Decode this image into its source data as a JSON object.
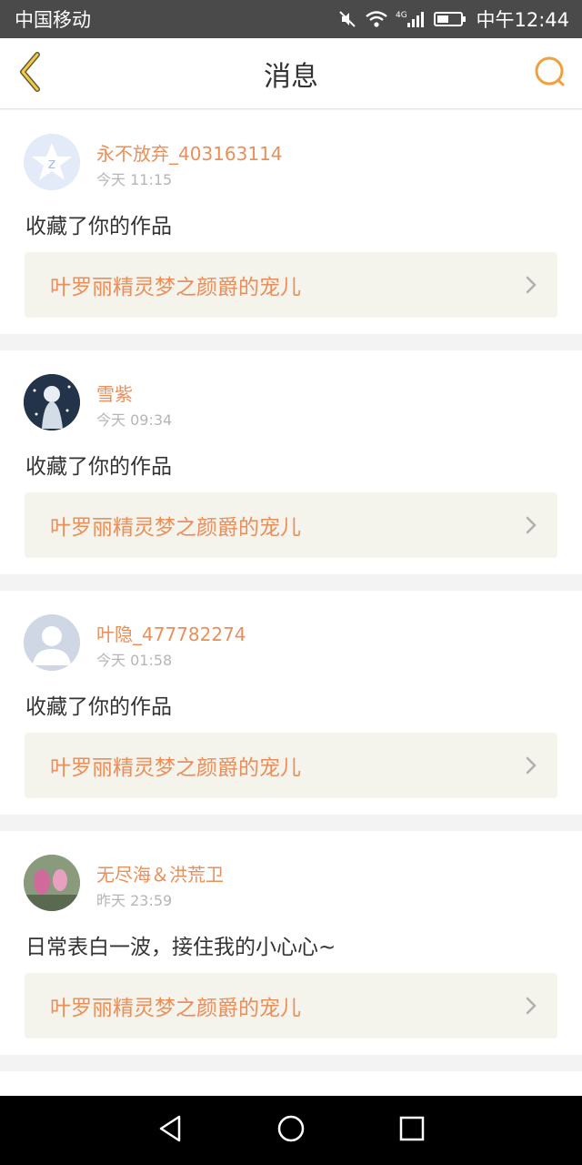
{
  "status_bar": {
    "carrier": "中国移动",
    "network": "4G",
    "time": "中午12:44",
    "icons": [
      "mute-icon",
      "wifi-icon",
      "signal-icon",
      "battery-icon"
    ]
  },
  "header": {
    "title": "消息",
    "back_icon": "chevron-left-icon",
    "search_icon": "search-icon",
    "accent_color": "#f0a03c"
  },
  "colors": {
    "name_color": "#ea8f5a",
    "link_bg": "#f4f3ec",
    "time_color": "#b6b6b6"
  },
  "messages": [
    {
      "user": "永不放弃_403163114",
      "time": "今天 11:15",
      "action": "收藏了你的作品",
      "work_title": "叶罗丽精灵梦之颜爵的宠儿",
      "avatar": "default-qq-avatar"
    },
    {
      "user": "雪紫",
      "time": "今天 09:34",
      "action": "收藏了你的作品",
      "work_title": "叶罗丽精灵梦之颜爵的宠儿",
      "avatar": "anime-character-avatar"
    },
    {
      "user": "叶隐_477782274",
      "time": "今天 01:58",
      "action": "收藏了你的作品",
      "work_title": "叶罗丽精灵梦之颜爵的宠儿",
      "avatar": "default-person-avatar"
    },
    {
      "user": "无尽海＆洪荒卫",
      "time": "昨天 23:59",
      "action": "日常表白一波，接住我的小心心~",
      "work_title": "叶罗丽精灵梦之颜爵的宠儿",
      "avatar": "photo-avatar"
    }
  ],
  "nav": {
    "icons": [
      "back-triangle-icon",
      "home-circle-icon",
      "recents-square-icon"
    ]
  }
}
